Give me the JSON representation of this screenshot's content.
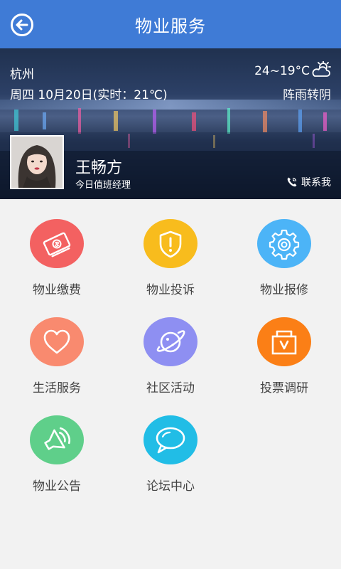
{
  "header": {
    "title": "物业服务",
    "back_icon": "back-arrow-icon"
  },
  "weather": {
    "city": "杭州",
    "date": "周四 10月20日(实时：21℃)",
    "temp_range": "24~19°C",
    "condition": "阵雨转阴",
    "icon": "cloudy-sun-icon"
  },
  "manager": {
    "name": "王畅方",
    "role": "今日值班经理",
    "contact_label": "联系我"
  },
  "services": [
    {
      "label": "物业缴费",
      "icon": "payment-bill-icon",
      "color": "#f36161"
    },
    {
      "label": "物业投诉",
      "icon": "complaint-shield-icon",
      "color": "#f8bc1d"
    },
    {
      "label": "物业报修",
      "icon": "repair-gear-icon",
      "color": "#4cb4f7"
    },
    {
      "label": "生活服务",
      "icon": "heart-icon",
      "color": "#f98a6f"
    },
    {
      "label": "社区活动",
      "icon": "planet-icon",
      "color": "#8e8ff2"
    },
    {
      "label": "投票调研",
      "icon": "vote-box-icon",
      "color": "#fb7f16"
    },
    {
      "label": "物业公告",
      "icon": "speaker-icon",
      "color": "#5fcf8a"
    },
    {
      "label": "论坛中心",
      "icon": "chat-bubble-icon",
      "color": "#21bde6"
    }
  ]
}
